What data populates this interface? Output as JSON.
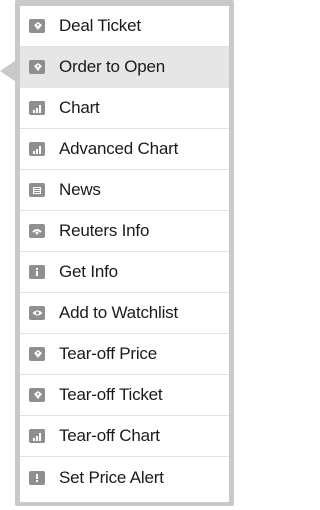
{
  "menu": {
    "items": [
      {
        "label": "Deal Ticket",
        "icon": "ticket-icon"
      },
      {
        "label": "Order to Open",
        "icon": "ticket-icon",
        "highlighted": true
      },
      {
        "label": "Chart",
        "icon": "bar-chart-icon"
      },
      {
        "label": "Advanced Chart",
        "icon": "bar-chart-icon"
      },
      {
        "label": "News",
        "icon": "newspaper-icon"
      },
      {
        "label": "Reuters Info",
        "icon": "reuters-icon"
      },
      {
        "label": "Get Info",
        "icon": "info-icon"
      },
      {
        "label": "Add to Watchlist",
        "icon": "eye-icon"
      },
      {
        "label": "Tear-off Price",
        "icon": "ticket-icon"
      },
      {
        "label": "Tear-off Ticket",
        "icon": "ticket-icon"
      },
      {
        "label": "Tear-off Chart",
        "icon": "bar-chart-icon"
      },
      {
        "label": "Set Price Alert",
        "icon": "alert-icon"
      }
    ]
  },
  "colors": {
    "frame": "#c9c9c9",
    "icon": "#8f8f8f",
    "hover": "#e6e6e6",
    "text": "#1a1a1a"
  }
}
